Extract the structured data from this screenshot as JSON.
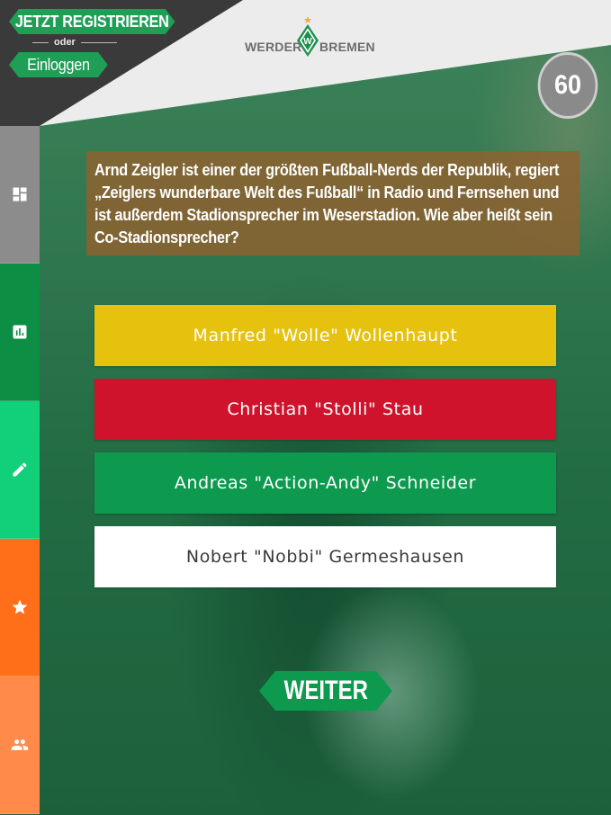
{
  "auth": {
    "register_label": "JETZT REGISTRIEREN",
    "or_label": "oder",
    "login_label": "Einloggen"
  },
  "logo": {
    "left_text": "WERDER",
    "right_text": "BREMEN"
  },
  "timer": {
    "value": "60"
  },
  "sidebar": {
    "items": [
      {
        "name": "dashboard",
        "icon": "dashboard-icon",
        "color": "#8c8c8c"
      },
      {
        "name": "statistics",
        "icon": "bar-chart-icon",
        "color": "#0c8f45"
      },
      {
        "name": "quiz",
        "icon": "pencil-icon",
        "color": "#12d07a"
      },
      {
        "name": "favorites",
        "icon": "star-icon",
        "color": "#ff6f1a"
      },
      {
        "name": "community",
        "icon": "people-icon",
        "color": "#ff8a4a"
      }
    ]
  },
  "question": {
    "text": "Arnd Zeigler ist einer der größten Fußball-Nerds der Republik, regiert „Zeiglers wunderbare Welt des Fußball“ in Radio und Fernsehen und ist außerdem Stadionsprecher im Weserstadion. Wie aber heißt sein Co-Stadionsprecher?"
  },
  "answers": [
    {
      "label": "Manfred \"Wolle\" Wollenhaupt",
      "color": "#e6c20f"
    },
    {
      "label": "Christian \"Stolli\" Stau",
      "color": "#d0132d"
    },
    {
      "label": "Andreas \"Action-Andy\" Schneider",
      "color": "#0d9a4f"
    },
    {
      "label": "Nobert \"Nobbi\" Germeshausen",
      "color": "#ffffff"
    }
  ],
  "next_button": {
    "label": "WEITER"
  }
}
